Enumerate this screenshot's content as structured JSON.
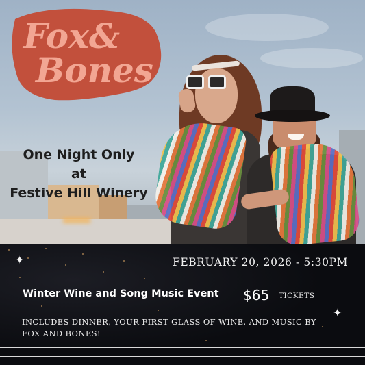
{
  "brand": {
    "logo_line1": "Fox&",
    "logo_line2": "Bones"
  },
  "headline": {
    "line1": "One Night Only",
    "line2": "at",
    "line3": "Festive Hill Winery"
  },
  "event": {
    "date_time": "FEBRUARY 20, 2026 - 5:30PM",
    "title": "Winter Wine and Song Music Event",
    "price": "$65",
    "price_label": "TICKETS",
    "includes": "INCLUDES DINNER, YOUR FIRST GLASS OF WINE, AND MUSIC BY FOX AND BONES!"
  },
  "icons": {
    "sparkle_left": "sparkle-icon",
    "sparkle_right": "sparkle-icon"
  },
  "colors": {
    "logo_fill": "#f2a693",
    "logo_shadow": "#c2503c",
    "panel_bg": "#0b0c10",
    "text_light": "#f0f0f0"
  }
}
